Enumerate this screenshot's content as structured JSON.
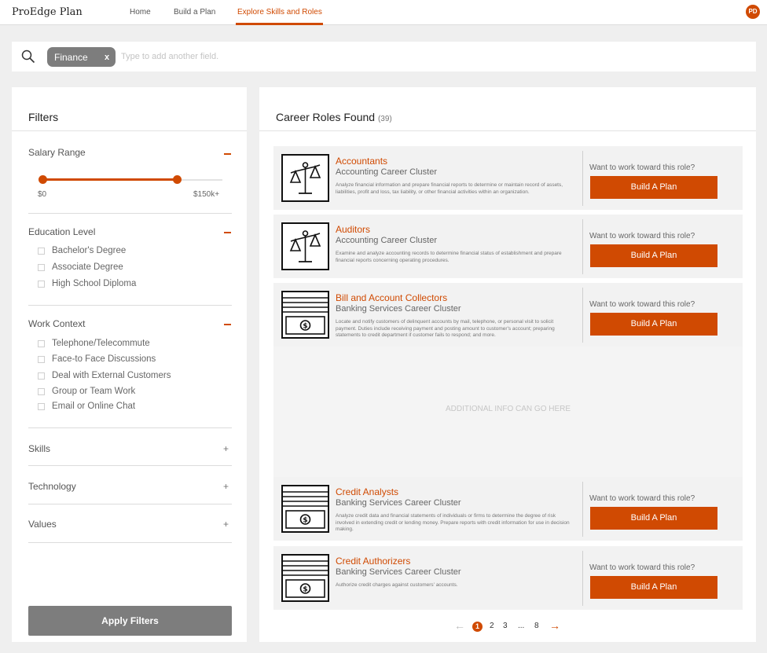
{
  "app": {
    "brand": "ProEdge Plan"
  },
  "nav": {
    "items": [
      "Home",
      "Build a Plan",
      "Explore Skills and Roles"
    ],
    "active_index": 2
  },
  "user": {
    "initials": "PD"
  },
  "search": {
    "chip_label": "Finance",
    "chip_remove": "x",
    "placeholder": "Type to add another field."
  },
  "filters": {
    "title": "Filters",
    "salary": {
      "title": "Salary Range",
      "min_label": "$0",
      "max_label": "$150k+",
      "selected_fraction": 0.75
    },
    "education": {
      "title": "Education Level",
      "options": [
        "Bachelor's Degree",
        "Associate Degree",
        "High School Diploma"
      ]
    },
    "work_context": {
      "title": "Work Context",
      "options": [
        "Telephone/Telecommute",
        "Face-to Face Discussions",
        "Deal with External Customers",
        "Group or Team Work",
        "Email or Online Chat"
      ]
    },
    "collapsed_sections": [
      "Skills",
      "Technology",
      "Values"
    ],
    "apply_label": "Apply Filters"
  },
  "results": {
    "title": "Career Roles Found",
    "count": "(39)",
    "prompt": "Want to work toward this role?",
    "button_label": "Build A Plan",
    "additional_info": "ADDITIONAL INFO CAN GO HERE",
    "roles": [
      {
        "title": "Accountants",
        "cluster": "Accounting Career Cluster",
        "icon": "scales-icon",
        "description": "Analyze financial information and prepare financial reports to determine or maintain record of assets, liabilities, profit and loss, tax liability, or other financial activities within an organization."
      },
      {
        "title": "Auditors",
        "cluster": "Accounting Career Cluster",
        "icon": "scales-icon",
        "description": "Examine and analyze accounting records to determine financial status of establishment and prepare financial reports concerning operating procedures."
      },
      {
        "title": "Bill and Account Collectors",
        "cluster": "Banking Services Career Cluster",
        "icon": "cash-stack-icon",
        "description": "Locate and notify customers of delinquent accounts by mail, telephone, or personal visit to solicit payment. Duties include receiving payment and posting amount to customer's account; preparing statements to credit department if customer fails to respond; and more."
      },
      {
        "title": "Credit Analysts",
        "cluster": "Banking Services Career Cluster",
        "icon": "cash-stack-icon",
        "description": "Analyze credit data and financial statements of individuals or firms to determine the degree of risk involved in extending credit or lending money. Prepare reports with credit information for use in decision making."
      },
      {
        "title": "Credit Authorizers",
        "cluster": "Banking Services Career Cluster",
        "icon": "cash-stack-icon",
        "description": "Authorize credit charges against customers' accounts."
      }
    ]
  },
  "pagination": {
    "current": "1",
    "pages": [
      "2",
      "3"
    ],
    "ellipsis": "...",
    "last": "8",
    "prev": "←",
    "next": "→"
  },
  "colors": {
    "accent": "#d04a02",
    "chip": "#7d7d7d",
    "panel": "#ffffff",
    "background": "#efefef"
  }
}
